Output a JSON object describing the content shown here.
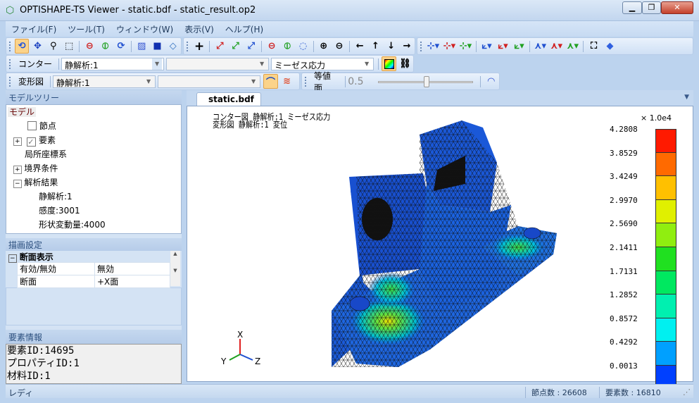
{
  "window": {
    "title": "OPTISHAPE-TS Viewer - static.bdf - static_result.op2",
    "minimize": "▁",
    "restore": "❐",
    "close": "✕"
  },
  "menu": [
    "ファイル(F)",
    "ツール(T)",
    "ウィンドウ(W)",
    "表示(V)",
    "ヘルプ(H)"
  ],
  "contour_toolbar": {
    "label": "コンター",
    "analysis": "静解析:1",
    "sub": "",
    "quantity": "ミーゼス応力"
  },
  "deform_toolbar": {
    "label": "変形図",
    "analysis": "静解析:1",
    "sub": ""
  },
  "isosurface_toolbar": {
    "label": "等値面",
    "value": "0.5",
    "slider_fraction": 0.5
  },
  "model_tree": {
    "header": "モデルツリー",
    "root": "モデル",
    "items": [
      "節点",
      "要素",
      "局所座標系",
      "境界条件",
      "解析結果"
    ],
    "results": [
      "静解析:1",
      "感度:3001",
      "形状変動量:4000"
    ]
  },
  "draw_settings": {
    "header": "描画設定",
    "section": "断面表示",
    "rows": [
      {
        "name": "有効/無効",
        "value": "無効"
      },
      {
        "name": "断面",
        "value": "+X面"
      }
    ]
  },
  "element_info": {
    "header": "要素情報",
    "lines": [
      "要素ID:14695",
      "プロパティID:1",
      "材料ID:1"
    ]
  },
  "tab": {
    "label": "static.bdf",
    "close": "×"
  },
  "viewport": {
    "caption1": "コンター図 静解析:1 ミーゼス応力",
    "caption2": "変形図 静解析:1 変位",
    "axes": {
      "x": "X",
      "y": "Y",
      "z": "Z"
    }
  },
  "legend": {
    "scale": "× 1.0e4",
    "values": [
      "4.2808",
      "3.8529",
      "3.4249",
      "2.9970",
      "2.5690",
      "2.1411",
      "1.7131",
      "1.2852",
      "0.8572",
      "0.4292",
      "0.0013"
    ],
    "colors": [
      "#ff1a00",
      "#ff6a00",
      "#ffc000",
      "#e0f000",
      "#90ee10",
      "#20e020",
      "#00e860",
      "#00f0b0",
      "#00f0f0",
      "#00a0ff",
      "#0040ff"
    ]
  },
  "status": {
    "ready": "レディ",
    "nodes": "節点数 : 26608",
    "elements": "要素数 : 16810"
  }
}
